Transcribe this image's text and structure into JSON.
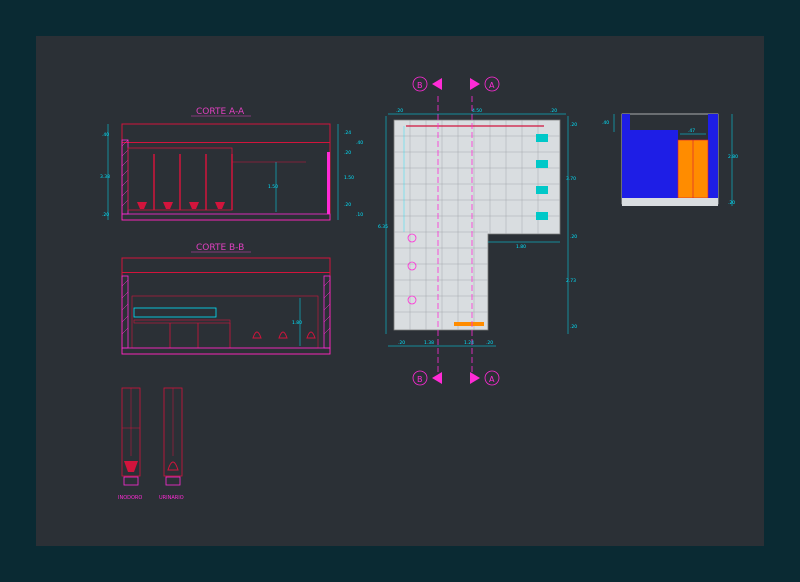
{
  "sections": {
    "corte_aa": {
      "title": "CORTE A-A",
      "dims": {
        "d1": ".40",
        "d2": "3.38",
        "d3": ".20",
        "d4": ".24",
        "d5": ".40",
        "d6": ".20",
        "d7": "1.50",
        "d8": "1.50",
        "d9": ".20",
        "d10": ".10"
      }
    },
    "corte_bb": {
      "title": "CORTE B-B",
      "dims": {
        "d1": "1.80"
      }
    },
    "plan": {
      "markers": {
        "top_b": "B",
        "top_a": "A",
        "bottom_b": "B",
        "bottom_a": "A"
      },
      "dims": {
        "top_left": ".20",
        "top_mid": "4.50",
        "top_right": ".20",
        "left_total": "6.35",
        "right_upper": "3.70",
        "right_lower": "2.73",
        "right_t1": ".20",
        "right_t2": ".20",
        "right_t3": ".20",
        "inner": "1.80",
        "bottom_1": ".20",
        "bottom_2": "1.38",
        "bottom_3": "1.24",
        "bottom_4": ".20"
      }
    },
    "elevation": {
      "dims": {
        "top_left": ".40",
        "door": ".47",
        "height": "2.80",
        "base": ".20"
      }
    },
    "fixtures": {
      "inodoro": "INODORO",
      "urinario": "URINARIO"
    }
  },
  "colors": {
    "background": "#2b3036",
    "outer": "#0a2a33",
    "dim": "#00e5ff",
    "wall": "#d2143c",
    "magenta": "#ff2bd6",
    "title": "#e040c0",
    "tile": "#d9dde0",
    "blue": "#1e1ee6",
    "orange": "#ff8c00"
  }
}
